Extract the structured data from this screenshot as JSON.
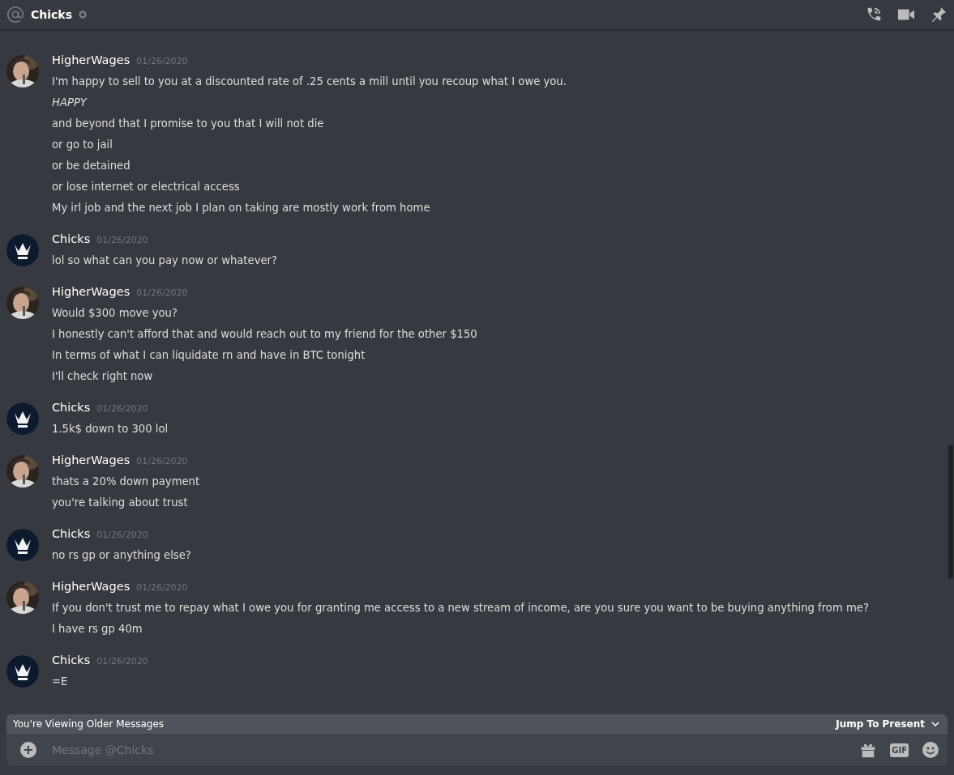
{
  "header": {
    "channel": "Chicks"
  },
  "messages": [
    {
      "author": "HigherWages",
      "date": "01/26/2020",
      "lines": [
        {
          "text": "I'm happy to sell to you at a discounted rate of .25 cents a mill until you recoup what I owe you.",
          "italic": false
        },
        {
          "text": "HAPPY",
          "italic": true
        },
        {
          "text": "and beyond that I promise to you that I will not die",
          "italic": false
        },
        {
          "text": "or go to jail",
          "italic": false
        },
        {
          "text": "or be detained",
          "italic": false
        },
        {
          "text": "or lose internet or electrical access",
          "italic": false
        },
        {
          "text": "My irl job and the next job I plan on taking are mostly work from home",
          "italic": false
        }
      ]
    },
    {
      "author": "Chicks",
      "kind": "crown",
      "date": "01/26/2020",
      "lines": [
        {
          "text": "lol so what can you pay now or whatever?",
          "italic": false
        }
      ]
    },
    {
      "author": "HigherWages",
      "date": "01/26/2020",
      "lines": [
        {
          "text": "Would $300 move you?",
          "italic": false
        },
        {
          "text": "I honestly can't afford that and would reach out to my friend for the other $150",
          "italic": false
        },
        {
          "text": "In terms of what I can liquidate rn and have in BTC tonight",
          "italic": false
        },
        {
          "text": "I'll check right now",
          "italic": false
        }
      ]
    },
    {
      "author": "Chicks",
      "kind": "crown",
      "date": "01/26/2020",
      "lines": [
        {
          "text": "1.5k$ down to 300 lol",
          "italic": false
        }
      ]
    },
    {
      "author": "HigherWages",
      "date": "01/26/2020",
      "lines": [
        {
          "text": "thats a 20% down payment",
          "italic": false
        },
        {
          "text": "you're talking about trust",
          "italic": false
        }
      ]
    },
    {
      "author": "Chicks",
      "kind": "crown",
      "date": "01/26/2020",
      "lines": [
        {
          "text": "no rs gp or anything else?",
          "italic": false
        }
      ]
    },
    {
      "author": "HigherWages",
      "date": "01/26/2020",
      "lines": [
        {
          "text": "If you don't trust me to repay what I owe you for granting me access to a new stream of income, are you sure you want to be buying anything from me?",
          "italic": false
        },
        {
          "text": "I have rs gp 40m",
          "italic": false
        }
      ]
    },
    {
      "author": "Chicks",
      "kind": "crown",
      "date": "01/26/2020",
      "lines": [
        {
          "text": "=E",
          "italic": false
        }
      ]
    }
  ],
  "banner": {
    "text": "You're Viewing Older Messages",
    "action": "Jump To Present"
  },
  "composer": {
    "placeholder": "Message @Chicks",
    "gif": "GIF"
  }
}
